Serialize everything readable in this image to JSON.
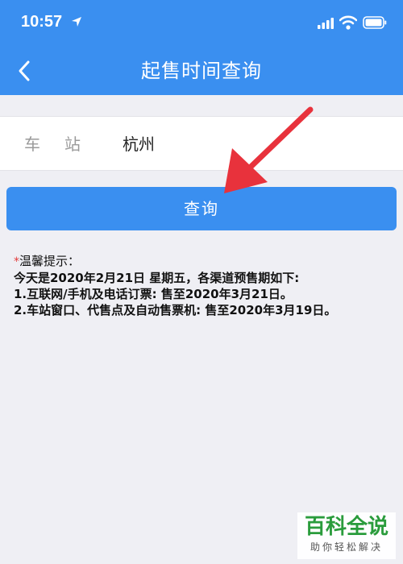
{
  "status_bar": {
    "time": "10:57"
  },
  "header": {
    "title": "起售时间查询"
  },
  "station": {
    "label": "车站",
    "value": "杭州"
  },
  "query_button": {
    "label": "查询"
  },
  "tips": {
    "title": "温馨提示：",
    "lines": [
      "今天是2020年2月21日 星期五，各渠道预售期如下:",
      "1.互联网/手机及电话订票: 售至2020年3月21日。",
      "2.车站窗口、代售点及自动售票机: 售至2020年3月19日。"
    ]
  },
  "watermark": {
    "main": "百科全说",
    "sub": "助你轻松解决"
  },
  "colors": {
    "primary": "#3a8ff0",
    "background": "#efeff4",
    "arrow": "#e8323c",
    "star": "#e23b3b"
  }
}
